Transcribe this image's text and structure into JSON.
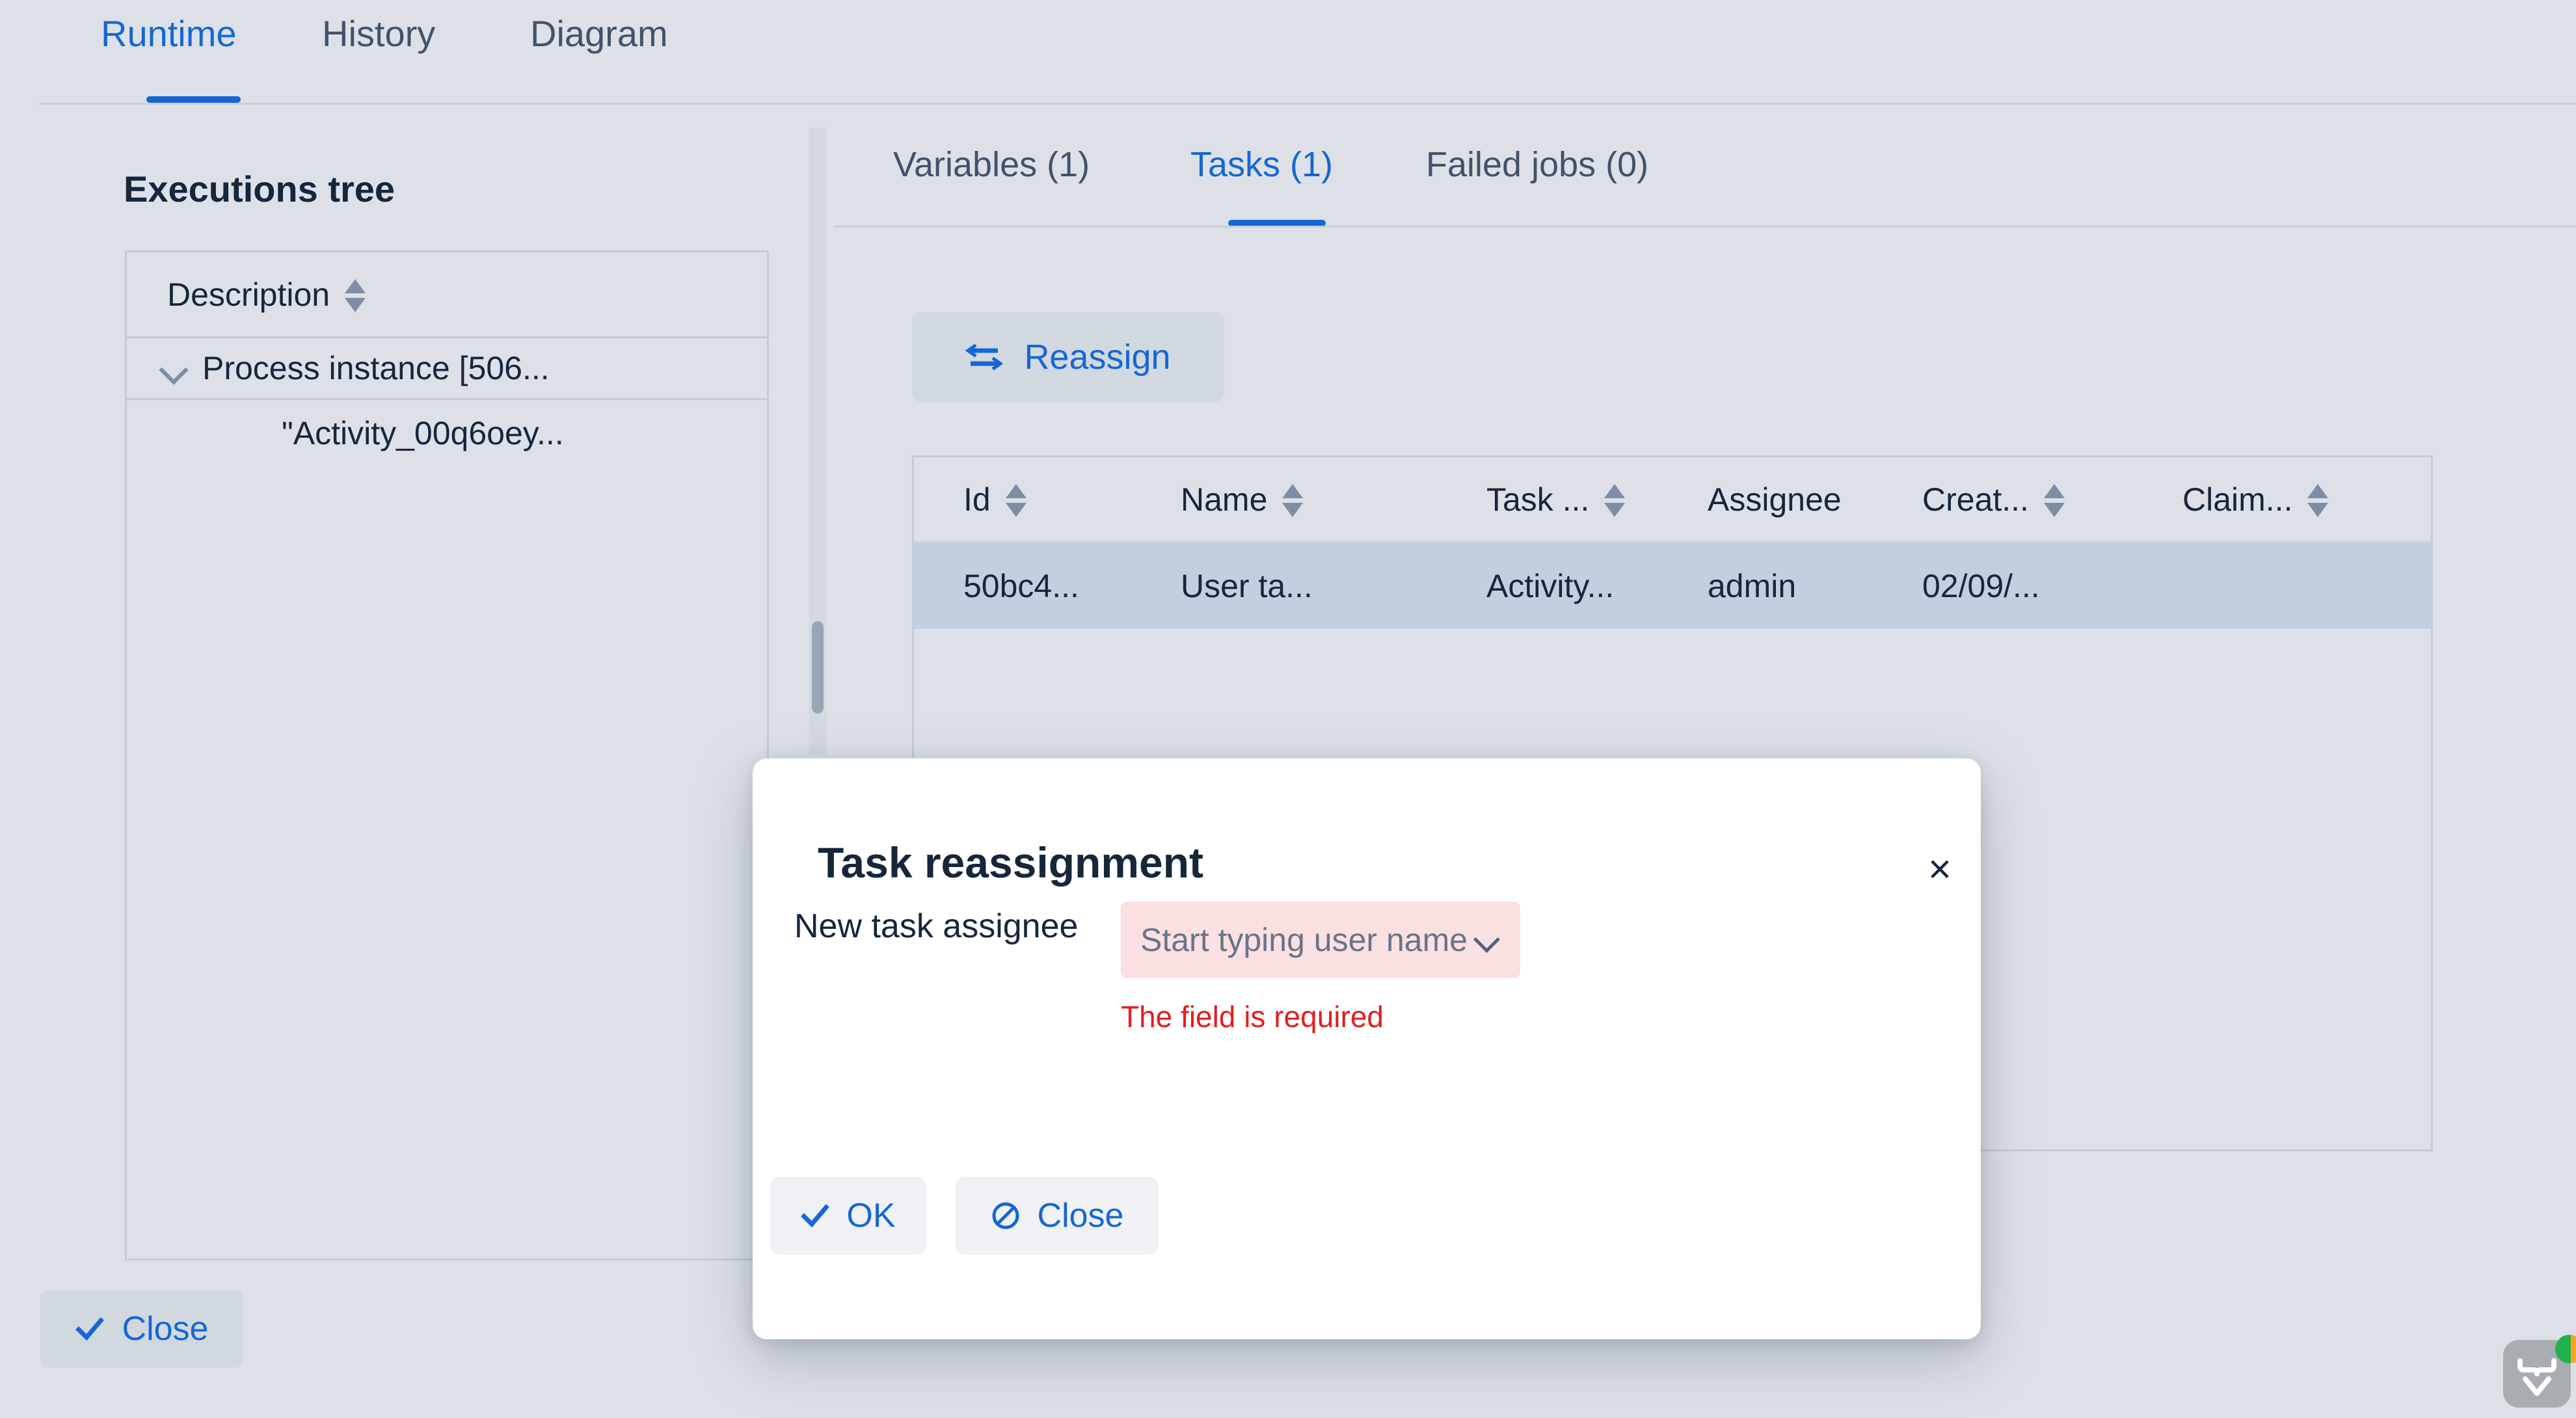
{
  "top_tabs": [
    {
      "label": "Runtime",
      "active": true
    },
    {
      "label": "History",
      "active": false
    },
    {
      "label": "Diagram",
      "active": false
    }
  ],
  "left_panel": {
    "title": "Executions tree",
    "column_header": "Description",
    "rows": [
      {
        "label": "Process instance [506...",
        "indent": false,
        "expanded": true
      },
      {
        "label": "\"Activity_00q6oey...",
        "indent": true,
        "expanded": false
      }
    ]
  },
  "right_panel": {
    "tabs": [
      {
        "label": "Variables (1)",
        "active": false
      },
      {
        "label": "Tasks (1)",
        "active": true
      },
      {
        "label": "Failed jobs (0)",
        "active": false
      }
    ],
    "reassign_button": {
      "label": "Reassign",
      "icon": "swap-arrows-icon"
    },
    "table": {
      "columns": [
        {
          "label": "Id",
          "sortable": true
        },
        {
          "label": "Name",
          "sortable": true
        },
        {
          "label": "Task ...",
          "sortable": true
        },
        {
          "label": "Assignee",
          "sortable": false
        },
        {
          "label": "Creat...",
          "sortable": true
        },
        {
          "label": "Claim...",
          "sortable": true
        }
      ],
      "rows": [
        {
          "id": "50bc4...",
          "name": "User ta...",
          "task": "Activity...",
          "assignee": "admin",
          "created": "02/09/...",
          "claimed": "",
          "selected": true
        }
      ]
    }
  },
  "footer": {
    "close_label": "Close",
    "close_icon": "check-icon"
  },
  "modal": {
    "title": "Task reassignment",
    "close_icon": "close-x-icon",
    "field": {
      "label": "New task assignee",
      "placeholder": "Start typing user name",
      "value": "",
      "error": "The field is required",
      "chevron_icon": "chevron-down-icon"
    },
    "buttons": [
      {
        "label": "OK",
        "icon": "check-icon"
      },
      {
        "label": "Close",
        "icon": "ban-icon"
      }
    ]
  },
  "corner_widget": {
    "icon": "browser-extension-icon"
  },
  "colors": {
    "accent_blue": "#1567d3",
    "page_bg": "#dde1e7",
    "text_dark": "#16263c",
    "text_muted": "#42526b",
    "error_red": "#e02020",
    "error_field_bg": "#fbe0e1",
    "row_selected_bg": "#c3cfe0"
  }
}
